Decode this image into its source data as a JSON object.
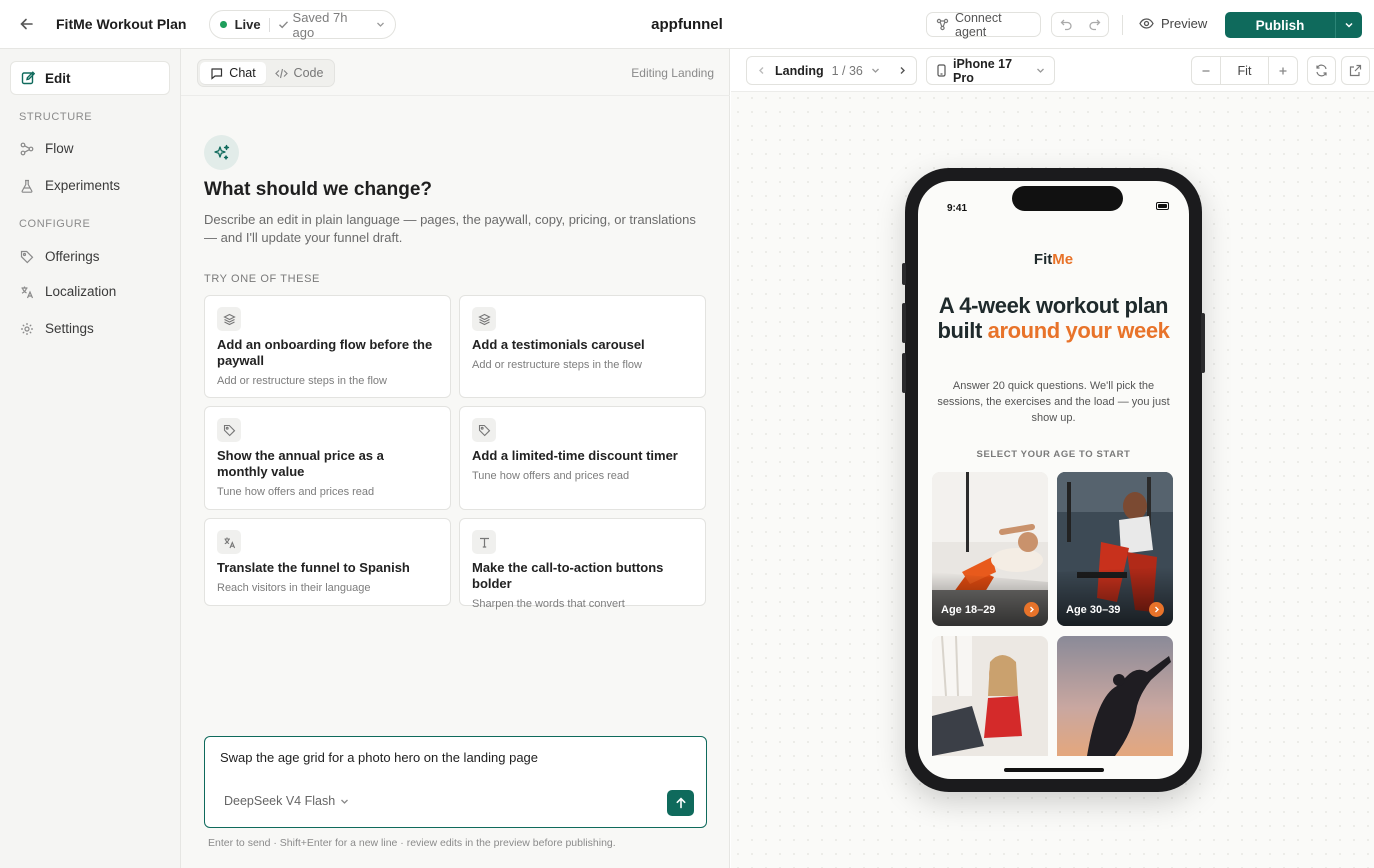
{
  "topbar": {
    "project_title": "FitMe Workout Plan",
    "status": "Live",
    "saved": "Saved 7h ago",
    "brand": "appfunnel",
    "connect_agent": "Connect agent",
    "preview": "Preview",
    "publish": "Publish"
  },
  "sidebar": {
    "edit": "Edit",
    "structure_heading": "STRUCTURE",
    "flow": "Flow",
    "experiments": "Experiments",
    "configure_heading": "CONFIGURE",
    "offerings": "Offerings",
    "localization": "Localization",
    "settings": "Settings"
  },
  "chat": {
    "tab_chat": "Chat",
    "tab_code": "Code",
    "editing": "Editing Landing",
    "heading": "What should we change?",
    "description": "Describe an edit in plain language — pages, the paywall, copy, pricing, or translations — and I'll update your funnel draft.",
    "try_heading": "TRY ONE OF THESE",
    "suggestions": [
      {
        "icon": "layers-icon",
        "title": "Add an onboarding flow before the paywall",
        "sub": "Add or restructure steps in the flow"
      },
      {
        "icon": "layers-icon",
        "title": "Add a testimonials carousel",
        "sub": "Add or restructure steps in the flow"
      },
      {
        "icon": "tag-icon",
        "title": "Show the annual price as a monthly value",
        "sub": "Tune how offers and prices read"
      },
      {
        "icon": "tag-icon",
        "title": "Add a limited-time discount timer",
        "sub": "Tune how offers and prices read"
      },
      {
        "icon": "translate-icon",
        "title": "Translate the funnel to Spanish",
        "sub": "Reach visitors in their language"
      },
      {
        "icon": "text-icon",
        "title": "Make the call-to-action buttons bolder",
        "sub": "Sharpen the words that convert"
      }
    ],
    "composer_text": "Swap the age grid for a photo hero on the landing page",
    "model": "DeepSeek V4 Flash",
    "hint": "Enter to send · Shift+Enter for a new line · review edits in the preview before publishing."
  },
  "canvas": {
    "page_name": "Landing",
    "page_count": "1 / 36",
    "device": "iPhone 17 Pro",
    "zoom": "Fit"
  },
  "phone": {
    "time": "9:41",
    "logo_a": "Fit",
    "logo_b": "Me",
    "hero_a": "A 4-week workout plan built ",
    "hero_b": "around your week",
    "sub": "Answer 20 quick questions. We'll pick the sessions, the exercises and the load — you just show up.",
    "age_label": "SELECT YOUR AGE TO START",
    "ages": [
      "Age 18–29",
      "Age 30–39"
    ]
  },
  "colors": {
    "accent": "#0f6a5c",
    "brand_orange": "#e8732a"
  }
}
